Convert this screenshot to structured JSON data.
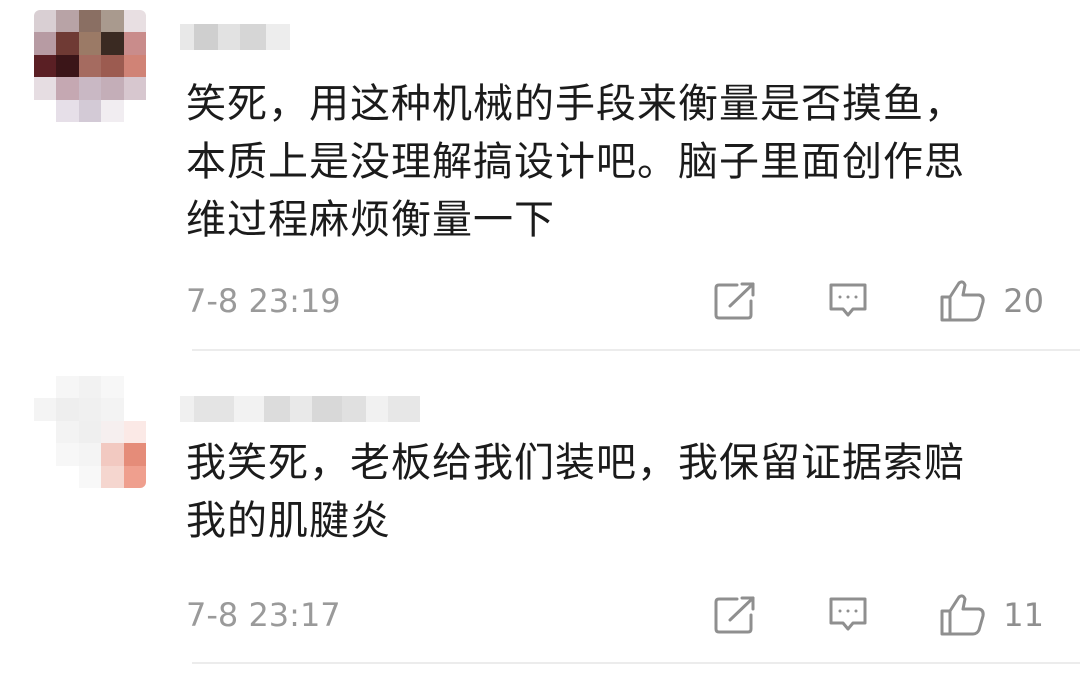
{
  "colors": {
    "text": "#1b1b1b",
    "meta": "#9a9a9a",
    "icon": "#8f8f8f",
    "divider": "#ececec",
    "background": "#ffffff"
  },
  "comments": [
    {
      "avatar_icon": "pixelated-avatar-icon",
      "text": "笑死，用这种机械的手段来衡量是否摸鱼，\n本质上是没理解搞设计吧。脑子里面创作思\n维过程麻烦衡量一下",
      "timestamp": "7-8 23:19",
      "like_count": "20",
      "icons": {
        "share": "share-icon",
        "reply": "comment-icon",
        "like": "thumbs-up-icon"
      }
    },
    {
      "avatar_icon": "pixelated-avatar-icon",
      "text": "我笑死，老板给我们装吧，我保留证据索赔\n我的肌腱炎",
      "timestamp": "7-8 23:17",
      "like_count": "11",
      "icons": {
        "share": "share-icon",
        "reply": "comment-icon",
        "like": "thumbs-up-icon"
      }
    }
  ]
}
